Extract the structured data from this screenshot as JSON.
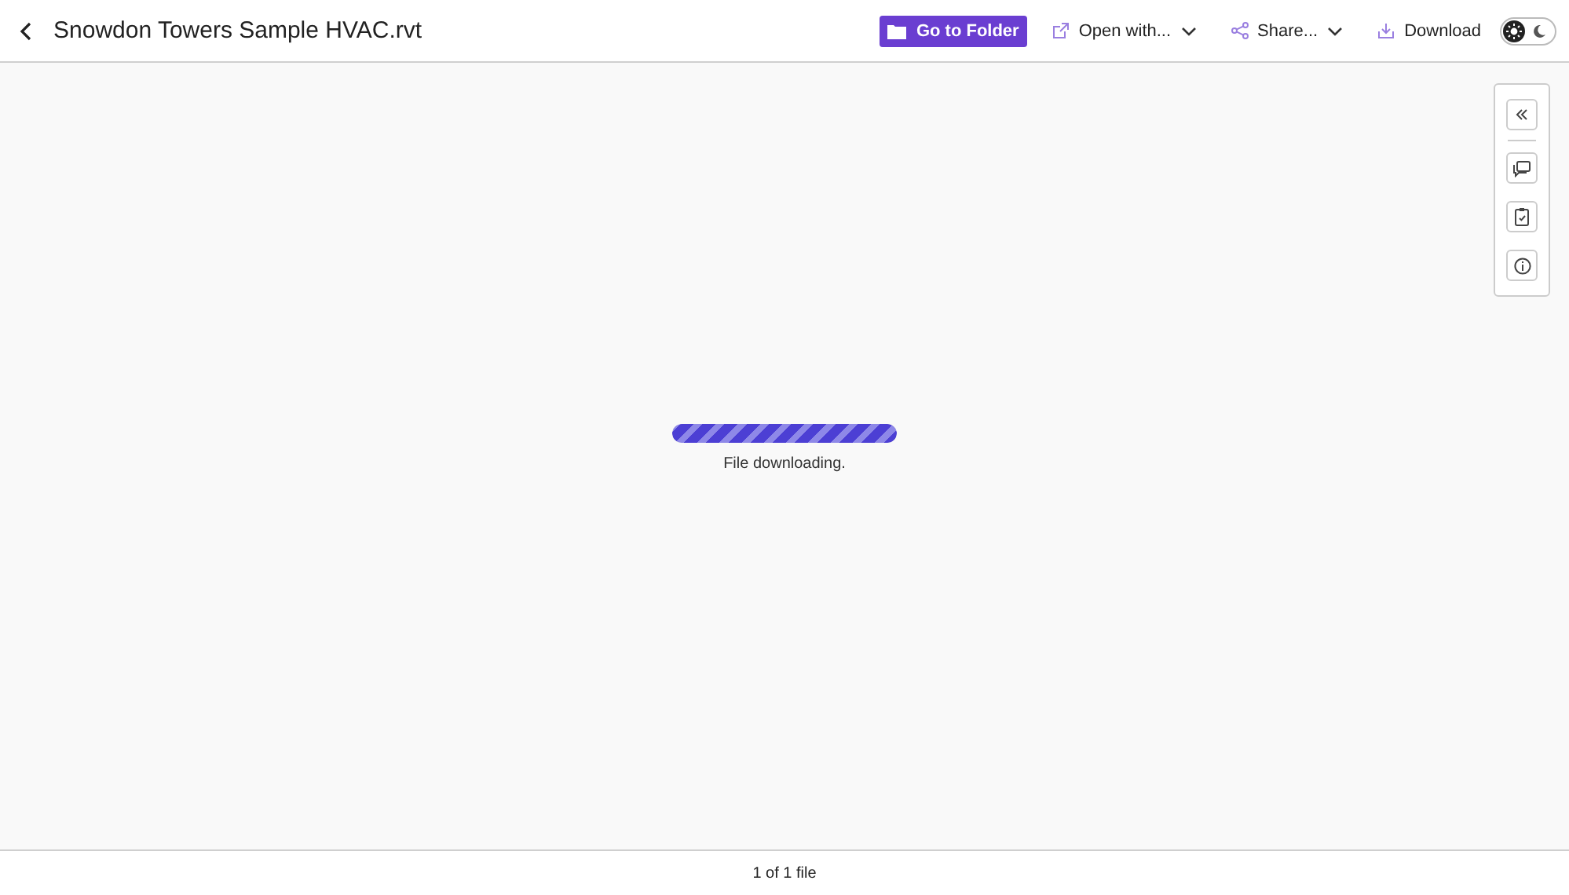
{
  "header": {
    "title": "Snowdon Towers Sample HVAC.rvt",
    "actions": [
      {
        "kind": "primary",
        "label": "Go to Folder"
      },
      {
        "kind": "menu",
        "label": "Open with..."
      },
      {
        "kind": "menu",
        "label": "Share..."
      },
      {
        "kind": "plain",
        "label": "Download"
      }
    ],
    "dark_mode": false
  },
  "progress": {
    "level": 1,
    "message": "File downloading."
  },
  "footer": {
    "count": "1 of 1 file"
  }
}
